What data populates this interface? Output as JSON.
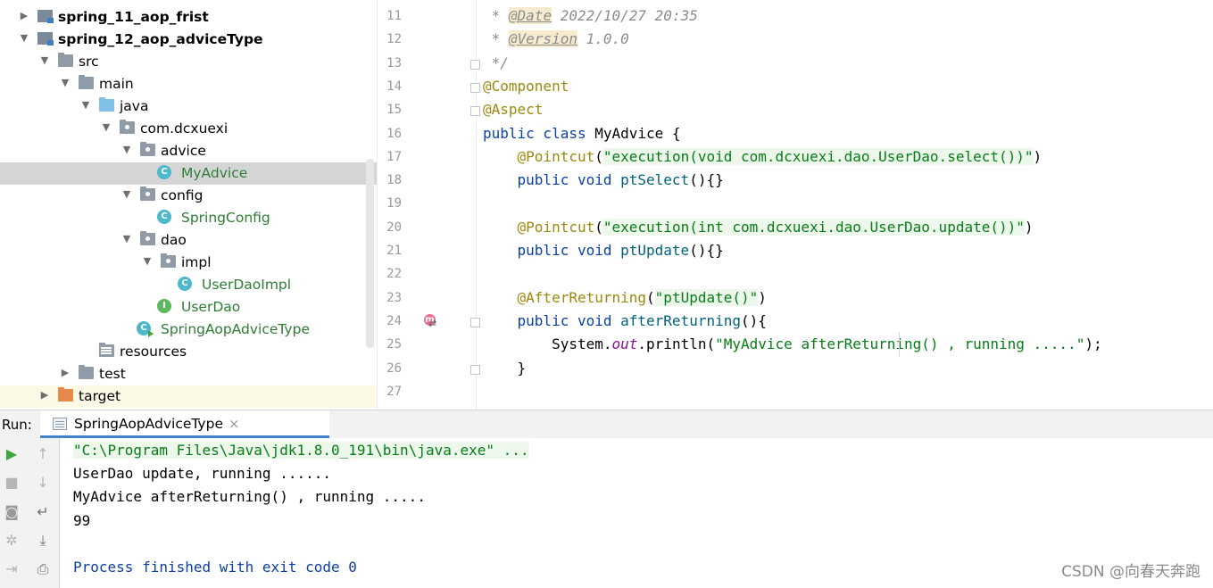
{
  "project_tree": [
    {
      "label": "spring_11_aop_frist",
      "type": "module",
      "level": 0,
      "expanded": false,
      "bold": true
    },
    {
      "label": "spring_12_aop_adviceType",
      "type": "module",
      "level": 0,
      "expanded": true,
      "bold": true
    },
    {
      "label": "src",
      "type": "folder",
      "level": 1,
      "expanded": true
    },
    {
      "label": "main",
      "type": "folder",
      "level": 2,
      "expanded": true
    },
    {
      "label": "java",
      "type": "source-folder",
      "level": 3,
      "expanded": true
    },
    {
      "label": "com.dcxuexi",
      "type": "package",
      "level": 4,
      "expanded": true
    },
    {
      "label": "advice",
      "type": "package",
      "level": 5,
      "expanded": true
    },
    {
      "label": "MyAdvice",
      "type": "class",
      "level": 6,
      "selected": true
    },
    {
      "label": "config",
      "type": "package",
      "level": 5,
      "expanded": true
    },
    {
      "label": "SpringConfig",
      "type": "class",
      "level": 6
    },
    {
      "label": "dao",
      "type": "package",
      "level": 5,
      "expanded": true
    },
    {
      "label": "impl",
      "type": "package",
      "level": 6,
      "expanded": true
    },
    {
      "label": "UserDaoImpl",
      "type": "class",
      "level": 7
    },
    {
      "label": "UserDao",
      "type": "interface",
      "level": 6
    },
    {
      "label": "SpringAopAdviceType",
      "type": "main-class",
      "level": 5
    },
    {
      "label": "resources",
      "type": "resources-folder",
      "level": 3
    },
    {
      "label": "test",
      "type": "folder",
      "level": 2,
      "expanded": false
    },
    {
      "label": "target",
      "type": "excluded-folder",
      "level": 1,
      "expanded": false,
      "highlight": true
    }
  ],
  "editor": {
    "first_line": 11,
    "lines": [
      [
        [
          "cmt",
          " * "
        ],
        [
          "doctag",
          "@Date"
        ],
        [
          "cmt",
          " 2022/10/27 20:35"
        ]
      ],
      [
        [
          "cmt",
          " * "
        ],
        [
          "doctag",
          "@Version"
        ],
        [
          "cmt",
          " 1.0.0"
        ]
      ],
      [
        [
          "cmt",
          " */"
        ]
      ],
      [
        [
          "ann",
          "@Component"
        ]
      ],
      [
        [
          "ann",
          "@Aspect"
        ]
      ],
      [
        [
          "kw",
          "public class "
        ],
        [
          "plain",
          "MyAdvice {"
        ]
      ],
      [
        [
          "plain",
          "    "
        ],
        [
          "ann",
          "@Pointcut"
        ],
        [
          "plain",
          "("
        ],
        [
          "strbg",
          "\"execution(void com.dcxuexi.dao.UserDao.select())\""
        ],
        [
          "plain",
          ")"
        ]
      ],
      [
        [
          "plain",
          "    "
        ],
        [
          "kw",
          "public void "
        ],
        [
          "fn",
          "ptSelect"
        ],
        [
          "plain",
          "(){}"
        ]
      ],
      [],
      [
        [
          "plain",
          "    "
        ],
        [
          "ann",
          "@Pointcut"
        ],
        [
          "plain",
          "("
        ],
        [
          "strbg",
          "\"execution(int com.dcxuexi.dao.UserDao.update())\""
        ],
        [
          "plain",
          ")"
        ]
      ],
      [
        [
          "plain",
          "    "
        ],
        [
          "kw",
          "public void "
        ],
        [
          "fn",
          "ptUpdate"
        ],
        [
          "plain",
          "(){}"
        ]
      ],
      [],
      [
        [
          "plain",
          "    "
        ],
        [
          "ann",
          "@AfterReturning"
        ],
        [
          "plain",
          "("
        ],
        [
          "strbg",
          "\"ptUpdate()\""
        ],
        [
          "plain",
          ")"
        ]
      ],
      [
        [
          "plain",
          "    "
        ],
        [
          "kw",
          "public void "
        ],
        [
          "fn",
          "afterReturning"
        ],
        [
          "plain",
          "(){"
        ]
      ],
      [
        [
          "plain",
          "        System."
        ],
        [
          "fld",
          "out"
        ],
        [
          "plain",
          ".println("
        ],
        [
          "str",
          "\"MyAdvice afterReturning() , running .....\""
        ],
        [
          "plain",
          ");"
        ]
      ],
      [
        [
          "plain",
          "    }"
        ]
      ],
      []
    ],
    "fold_markers": [
      13,
      14,
      15,
      24,
      26
    ],
    "method_icon_line": 24
  },
  "run_panel": {
    "label": "Run:",
    "tab_label": "SpringAopAdviceType",
    "tab_close": "×",
    "output": [
      {
        "text": "\"C:\\Program Files\\Java\\jdk1.8.0_191\\bin\\java.exe\" ...",
        "kind": "cmd"
      },
      {
        "text": "UserDao update, running ......",
        "kind": "out"
      },
      {
        "text": "MyAdvice afterReturning() , running .....",
        "kind": "out"
      },
      {
        "text": "99",
        "kind": "out"
      },
      {
        "text": "",
        "kind": "out"
      },
      {
        "text": "Process finished with exit code 0",
        "kind": "exit"
      }
    ],
    "toolbar": [
      {
        "name": "rerun-icon",
        "glyph": "▶",
        "color": "#3fa63f"
      },
      {
        "name": "stop-icon",
        "glyph": "■",
        "color": "#b5b5b5"
      },
      {
        "name": "camera-icon",
        "glyph": "◙",
        "color": "#9a9a9a"
      },
      {
        "name": "settings-icon",
        "glyph": "✲",
        "color": "#b5b5b5"
      },
      {
        "name": "exit-icon",
        "glyph": "⇥",
        "color": "#b5b5b5"
      },
      {
        "name": "up-arrow-icon",
        "glyph": "↑",
        "color": "#b5b5b5"
      },
      {
        "name": "down-arrow-icon",
        "glyph": "↓",
        "color": "#b5b5b5"
      },
      {
        "name": "soft-wrap-icon",
        "glyph": "↵",
        "color": "#6e6e6e"
      },
      {
        "name": "scroll-to-end-icon",
        "glyph": "⤓",
        "color": "#6e6e6e"
      },
      {
        "name": "print-icon",
        "glyph": "⎙",
        "color": "#6e6e6e"
      }
    ]
  },
  "watermark": "CSDN @向春天奔跑",
  "colors": {
    "keyword": "#0b3fa5",
    "annotation": "#9e880d",
    "string": "#067d17",
    "selection": "#d5d5d5",
    "tab_underline": "#4083c9"
  }
}
